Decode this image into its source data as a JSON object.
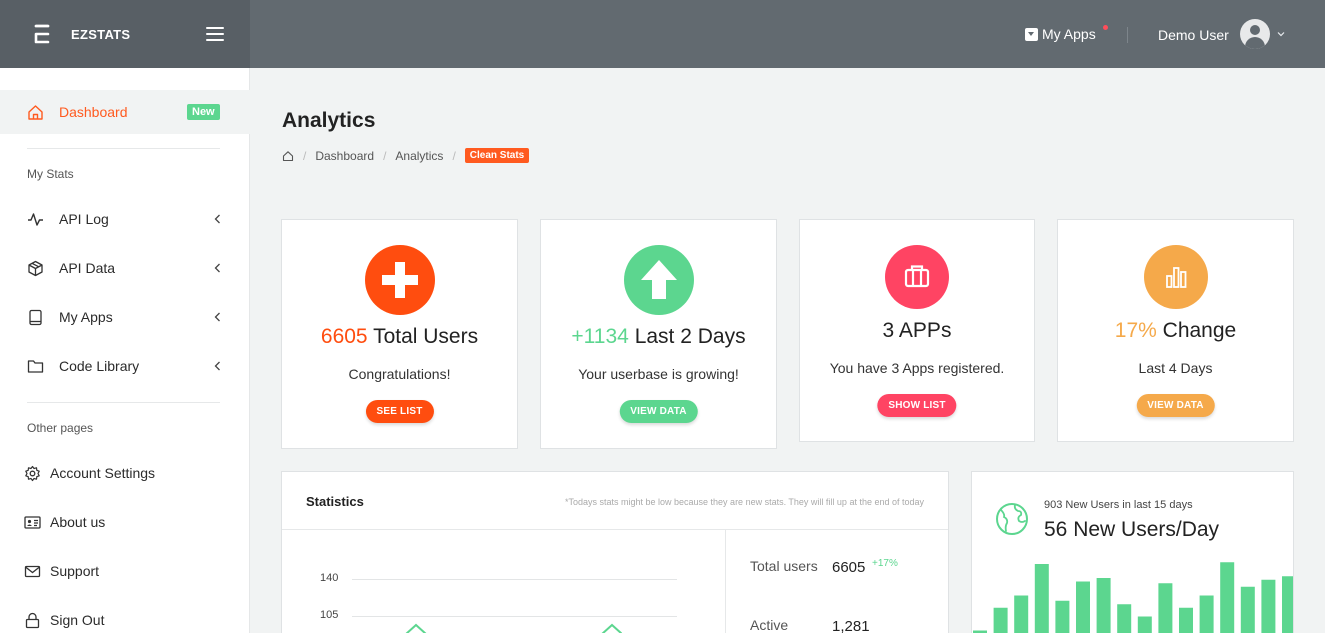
{
  "app": {
    "brand": "EZSTATS"
  },
  "topbar": {
    "my_apps": "My Apps",
    "user_name": "Demo User"
  },
  "sidebar": {
    "active": {
      "label": "Dashboard",
      "badge": "New"
    },
    "section1": "My Stats",
    "stats_items": [
      {
        "label": "API Log",
        "icon": "activity-icon"
      },
      {
        "label": "API Data",
        "icon": "box-icon"
      },
      {
        "label": "My Apps",
        "icon": "tablet-icon"
      },
      {
        "label": "Code Library",
        "icon": "folder-icon"
      }
    ],
    "section2": "Other pages",
    "other_items": [
      {
        "label": "Account Settings",
        "icon": "gear-icon"
      },
      {
        "label": "About us",
        "icon": "id-card-icon"
      },
      {
        "label": "Support",
        "icon": "envelope-icon"
      },
      {
        "label": "Sign Out",
        "icon": "lock-icon"
      }
    ]
  },
  "page": {
    "title": "Analytics",
    "breadcrumb": [
      "Dashboard",
      "Analytics"
    ],
    "breadcrumb_tag": "Clean Stats"
  },
  "cards": [
    {
      "value": "6605",
      "label": "Total Users",
      "sub": "Congratulations!",
      "button": "SEE LIST",
      "color": "#ff4d0f",
      "icon": "plus-icon"
    },
    {
      "value": "+1134",
      "label": "Last 2 Days",
      "sub": "Your userbase is growing!",
      "button": "VIEW DATA",
      "color": "#5cd68f",
      "icon": "arrow-up-icon"
    },
    {
      "value": "3",
      "label": "APPs",
      "sub": "You have 3 Apps registered.",
      "button": "SHOW LIST",
      "color": "#ff4463",
      "icon": "briefcase-icon"
    },
    {
      "value": "17%",
      "label": "Change",
      "sub": "Last 4 Days",
      "button": "VIEW DATA",
      "color": "#f5a94a",
      "icon": "bar-chart-icon"
    }
  ],
  "statistics": {
    "title": "Statistics",
    "note": "*Todays stats might be low because they are new stats. They will fill up at the end of today",
    "y_ticks": [
      "140",
      "105"
    ],
    "total_users_label": "Total users",
    "total_users_value": "6605",
    "total_users_change": "+17%",
    "active_label": "Active",
    "active_value": "1,281"
  },
  "new_users": {
    "caption": "903 New Users in last 15 days",
    "headline": "56 New Users/Day",
    "bar_color": "#5cd68f"
  },
  "chart_data": {
    "type": "bar",
    "values": [
      2,
      15,
      22,
      40,
      19,
      30,
      32,
      17,
      10,
      29,
      15,
      22,
      41,
      27,
      31,
      33
    ]
  }
}
